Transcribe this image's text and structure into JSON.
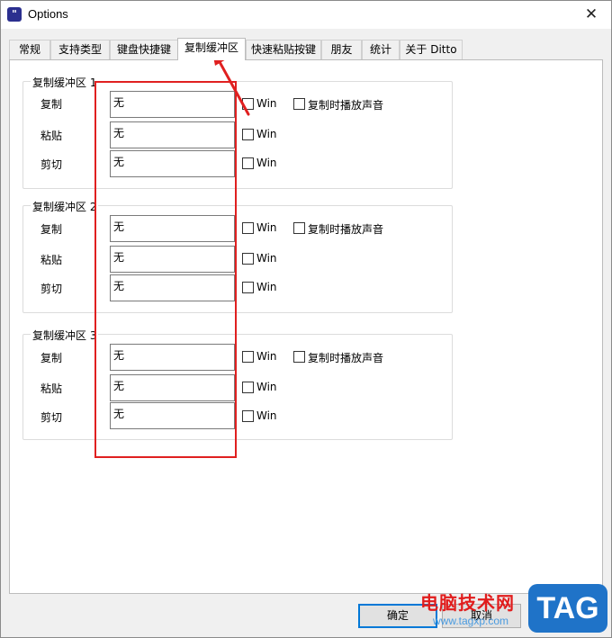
{
  "window": {
    "title": "Options",
    "close_glyph": "✕",
    "icon_glyph": "\""
  },
  "tabs": [
    {
      "label": "常规",
      "active": false
    },
    {
      "label": "支持类型",
      "active": false
    },
    {
      "label": "键盘快捷键",
      "active": false
    },
    {
      "label": "复制缓冲区",
      "active": true
    },
    {
      "label": "快速粘贴按键",
      "active": false
    },
    {
      "label": "朋友",
      "active": false
    },
    {
      "label": "统计",
      "active": false
    },
    {
      "label": "关于 Ditto",
      "active": false
    }
  ],
  "groups": [
    {
      "title": "复制缓冲区 1",
      "rows": [
        {
          "label": "复制",
          "value": "无",
          "win_label": "Win"
        },
        {
          "label": "粘贴",
          "value": "无",
          "win_label": "Win"
        },
        {
          "label": "剪切",
          "value": "无",
          "win_label": "Win"
        }
      ],
      "sound_label": "复制时播放声音"
    },
    {
      "title": "复制缓冲区 2",
      "rows": [
        {
          "label": "复制",
          "value": "无",
          "win_label": "Win"
        },
        {
          "label": "粘贴",
          "value": "无",
          "win_label": "Win"
        },
        {
          "label": "剪切",
          "value": "无",
          "win_label": "Win"
        }
      ],
      "sound_label": "复制时播放声音"
    },
    {
      "title": "复制缓冲区 3",
      "rows": [
        {
          "label": "复制",
          "value": "无",
          "win_label": "Win"
        },
        {
          "label": "粘贴",
          "value": "无",
          "win_label": "Win"
        },
        {
          "label": "剪切",
          "value": "无",
          "win_label": "Win"
        }
      ],
      "sound_label": "复制时播放声音"
    }
  ],
  "buttons": {
    "ok": "确定",
    "cancel": "取消"
  },
  "watermark": {
    "site_name": "电脑技术网",
    "url": "www.tagxp.com",
    "badge": "TAG"
  },
  "colors": {
    "highlight": "#e02020",
    "accent": "#0078d7",
    "badge": "#1f73c8"
  }
}
